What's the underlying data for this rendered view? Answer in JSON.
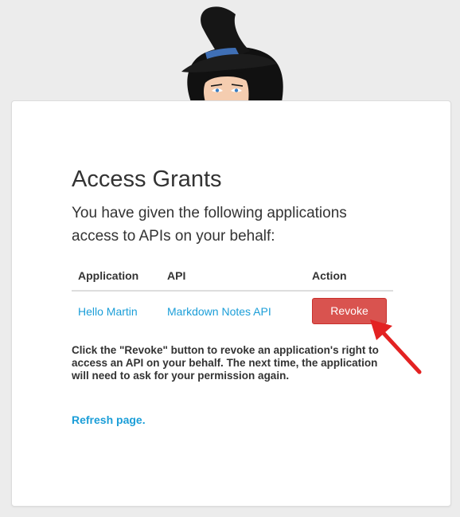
{
  "page": {
    "title": "Access Grants",
    "intro": "You have given the following applications access to APIs on your behalf:"
  },
  "table": {
    "headers": {
      "application": "Application",
      "api": "API",
      "action": "Action"
    },
    "rows": [
      {
        "application": "Hello Martin",
        "api": "Markdown Notes API",
        "action_label": "Revoke"
      }
    ]
  },
  "explanation": "Click the \"Revoke\" button to revoke an application's right to access an API on your behalf. The next time, the application will need to ask for your permission again.",
  "refresh_link": "Refresh page.",
  "icons": {
    "mascot": "witch-mascot-icon",
    "annotation": "red-arrow-icon"
  },
  "colors": {
    "link": "#1b9ed8",
    "revoke_button": "#d9534f",
    "annotation_arrow": "#e32222",
    "page_background": "#ececec"
  }
}
